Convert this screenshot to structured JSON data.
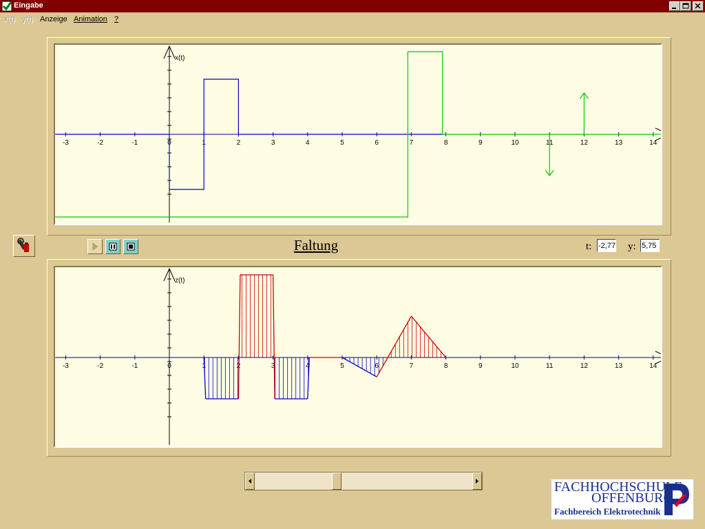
{
  "window": {
    "title": "Eingabe"
  },
  "menu": [
    {
      "label": "x(t)",
      "enabled": false
    },
    {
      "label": "y(t)",
      "enabled": false
    },
    {
      "label": "Anzeige",
      "enabled": true
    },
    {
      "label": "Animation",
      "enabled": true
    },
    {
      "label": "?",
      "enabled": true
    }
  ],
  "section_title": "Faltung",
  "coords": {
    "t_label": "t:",
    "t_value": "-2,77",
    "y_label": "y:",
    "y_value": "5,75"
  },
  "colors": {
    "x_signal": "#0000cc",
    "shifted_signal": "#00cc00",
    "negative_area": "#0000cc",
    "positive_area": "#cc0000",
    "plot_bg": "#fffde4"
  },
  "logo": {
    "line1": "FACHHOCHSCHULE",
    "line2": "OFFENBURG",
    "line3": "Fachbereich Elektrotechnik"
  },
  "scroll_position": 0.37,
  "chart_data": [
    {
      "type": "line",
      "ylabel": "x(t)",
      "xlim": [
        -3.3,
        14.3
      ],
      "x_ticks": [
        -3,
        -2,
        -1,
        0,
        1,
        2,
        3,
        4,
        5,
        6,
        7,
        8,
        9,
        10,
        11,
        12,
        13,
        14
      ],
      "series": [
        {
          "color": "#0000cc",
          "x": [
            -3.3,
            0,
            0,
            1,
            1,
            2,
            2,
            8
          ],
          "y": [
            0,
            0,
            -1,
            -1,
            1,
            1,
            0,
            0
          ]
        },
        {
          "color": "#00cc00",
          "x": [
            -3.3,
            6.9,
            6.9,
            7.9,
            7.9,
            14.3
          ],
          "y": [
            -1.5,
            -1.5,
            1.5,
            1.5,
            0,
            0
          ]
        }
      ],
      "impulses": [
        {
          "x": 11,
          "y": -0.75,
          "color": "#00cc00"
        },
        {
          "x": 12,
          "y": 0.75,
          "color": "#00cc00"
        }
      ]
    },
    {
      "type": "area",
      "ylabel": "z(t)",
      "xlim": [
        -3.3,
        14.3
      ],
      "x_ticks": [
        -3,
        -2,
        -1,
        0,
        1,
        2,
        3,
        4,
        5,
        6,
        7,
        8,
        9,
        10,
        11,
        12,
        13,
        14
      ],
      "curve": {
        "x": [
          1,
          1.05,
          2,
          2.05,
          3,
          3.05,
          4,
          4.05,
          5,
          6,
          7,
          8
        ],
        "y": [
          0,
          -1,
          -1,
          2,
          2,
          -1,
          -1,
          0,
          0,
          -0.47,
          1,
          0
        ]
      }
    }
  ]
}
